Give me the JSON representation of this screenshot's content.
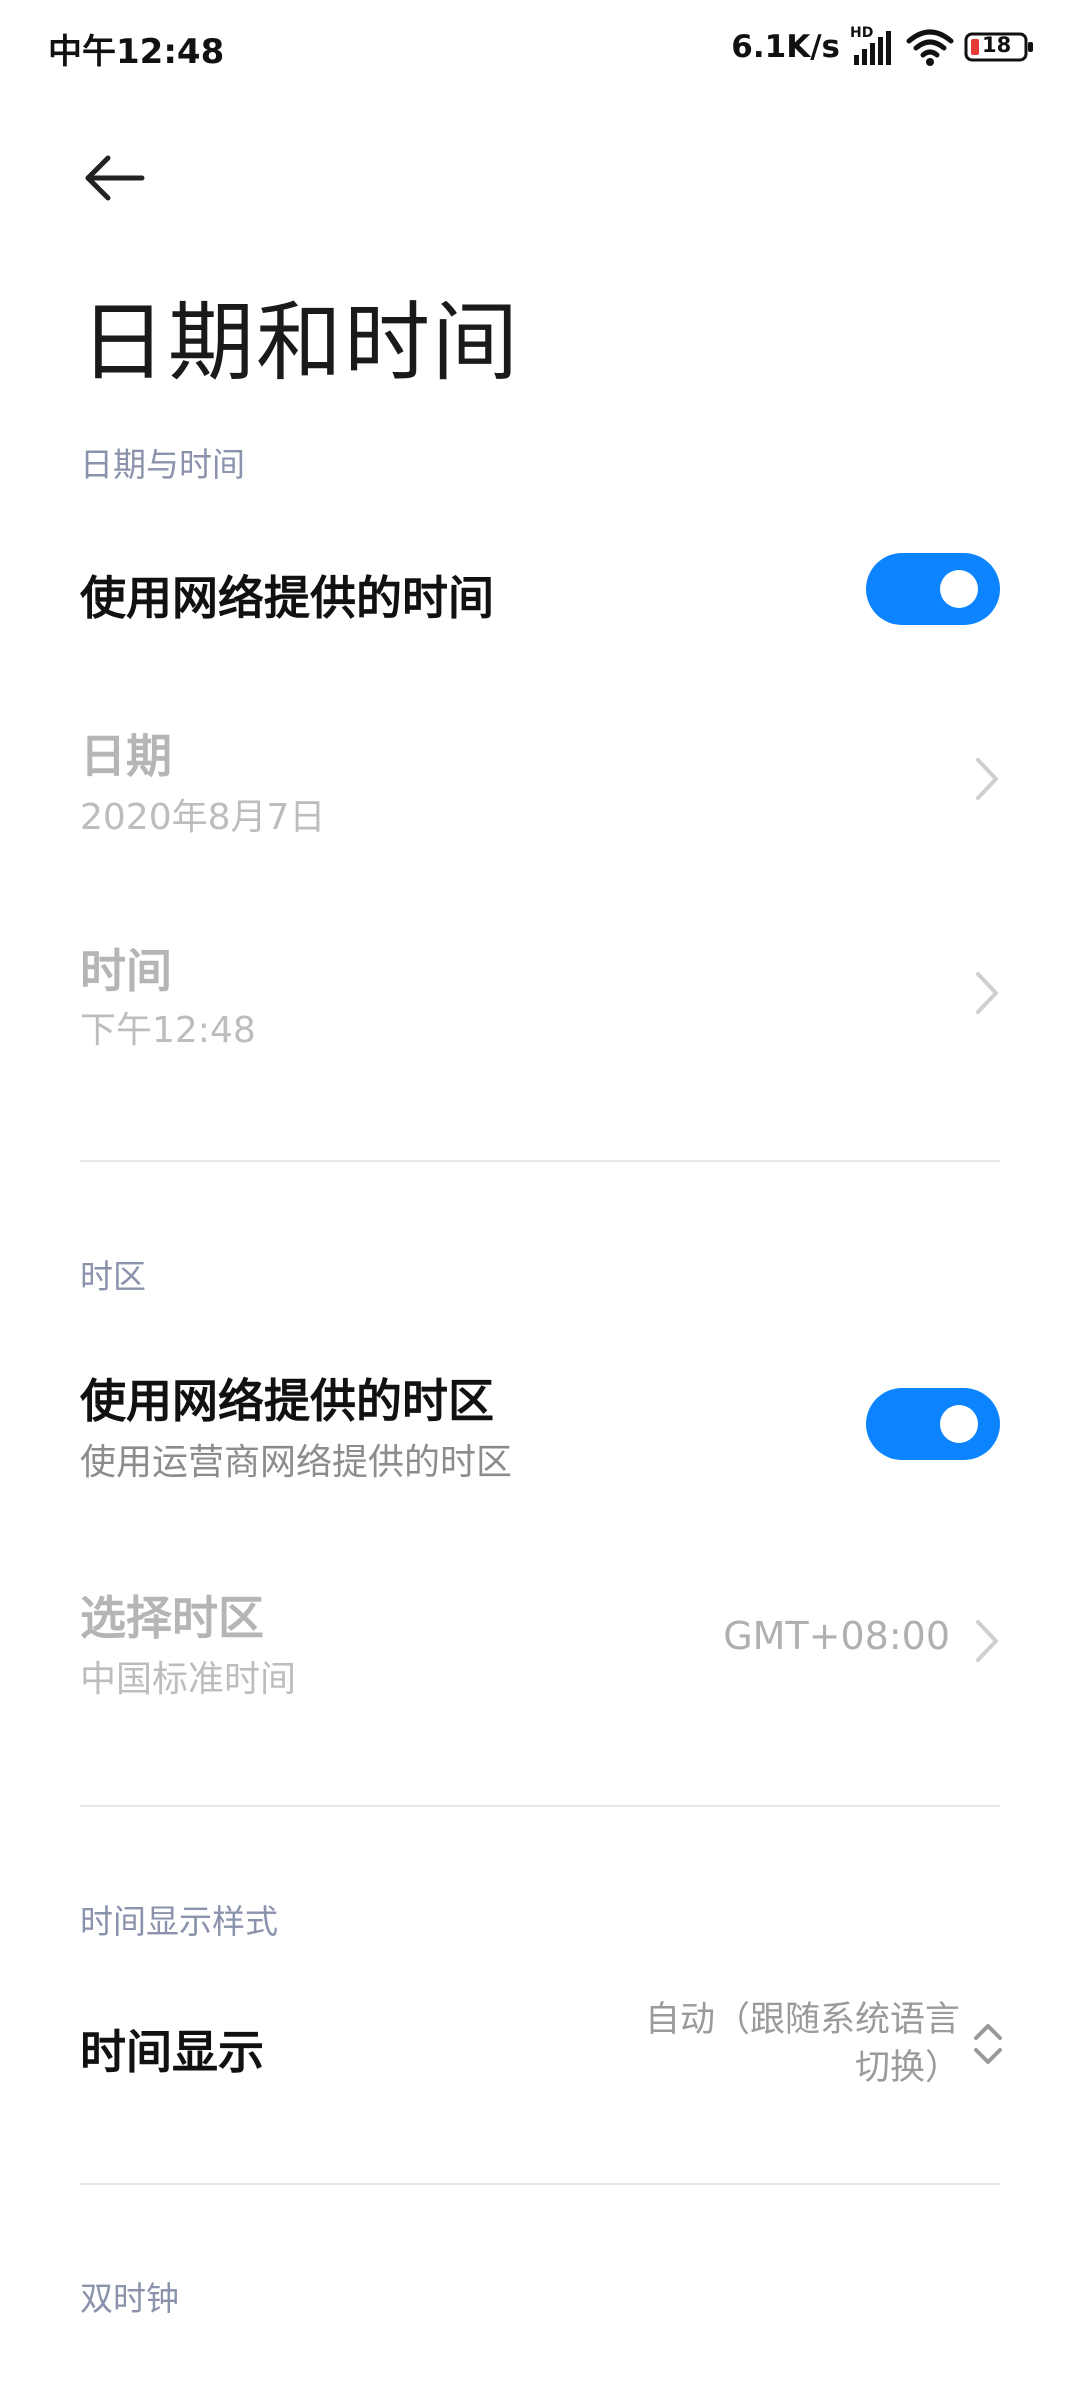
{
  "status_bar": {
    "time": "中午12:48",
    "network_speed": "6.1K/s",
    "signal_label": "HD",
    "battery_level": "18",
    "icons": [
      "hd-signal-icon",
      "wifi-icon",
      "battery-icon"
    ]
  },
  "header": {
    "back_icon": "arrow-left-icon",
    "title": "日期和时间"
  },
  "sections": {
    "date_time": {
      "header": "日期与时间",
      "network_time": {
        "title": "使用网络提供的时间",
        "enabled": true
      },
      "date": {
        "title": "日期",
        "value": "2020年8月7日"
      },
      "time": {
        "title": "时间",
        "value": "下午12:48"
      }
    },
    "timezone": {
      "header": "时区",
      "network_timezone": {
        "title": "使用网络提供的时区",
        "subtitle": "使用运营商网络提供的时区",
        "enabled": true
      },
      "select_timezone": {
        "title": "选择时区",
        "subtitle": "中国标准时间",
        "value": "GMT+08:00"
      }
    },
    "time_format": {
      "header": "时间显示样式",
      "time_display": {
        "title": "时间显示",
        "value_line1": "自动（跟随系统语言",
        "value_line2": "切换）"
      }
    },
    "dual_clock": {
      "header": "双时钟"
    }
  },
  "colors": {
    "accent": "#0c84ff",
    "section_header": "#8a93ab",
    "disabled_text": "#b5b5b5"
  }
}
